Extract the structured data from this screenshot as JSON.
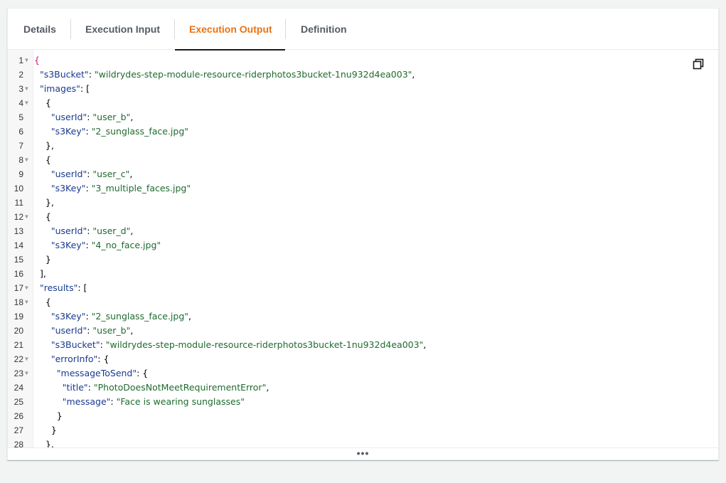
{
  "tabs": [
    {
      "label": "Details"
    },
    {
      "label": "Execution Input"
    },
    {
      "label": "Execution Output"
    },
    {
      "label": "Definition"
    }
  ],
  "active_tab": "Execution Output",
  "colors": {
    "active_tab": "#ec7211",
    "key": "#1a3a8f",
    "string": "#1e6b2e"
  },
  "icons": {
    "copy": "copy-icon",
    "fold": "fold-arrow-icon",
    "more": "ellipsis-icon"
  },
  "more_label": "•••",
  "code_lines": [
    {
      "n": "1",
      "fold": true,
      "parts": [
        {
          "t": "{",
          "c": "brace-hl"
        }
      ]
    },
    {
      "n": "2",
      "fold": false,
      "parts": [
        {
          "t": "  "
        },
        {
          "t": "\"s3Bucket\"",
          "c": "k"
        },
        {
          "t": ": "
        },
        {
          "t": "\"wildrydes-step-module-resource-riderphotos3bucket-1nu932d4ea003\"",
          "c": "s"
        },
        {
          "t": ","
        }
      ]
    },
    {
      "n": "3",
      "fold": true,
      "parts": [
        {
          "t": "  "
        },
        {
          "t": "\"images\"",
          "c": "k"
        },
        {
          "t": ": ["
        }
      ]
    },
    {
      "n": "4",
      "fold": true,
      "parts": [
        {
          "t": "    {"
        }
      ]
    },
    {
      "n": "5",
      "fold": false,
      "parts": [
        {
          "t": "      "
        },
        {
          "t": "\"userId\"",
          "c": "k"
        },
        {
          "t": ": "
        },
        {
          "t": "\"user_b\"",
          "c": "s"
        },
        {
          "t": ","
        }
      ]
    },
    {
      "n": "6",
      "fold": false,
      "parts": [
        {
          "t": "      "
        },
        {
          "t": "\"s3Key\"",
          "c": "k"
        },
        {
          "t": ": "
        },
        {
          "t": "\"2_sunglass_face.jpg\"",
          "c": "s"
        }
      ]
    },
    {
      "n": "7",
      "fold": false,
      "parts": [
        {
          "t": "    },"
        }
      ]
    },
    {
      "n": "8",
      "fold": true,
      "parts": [
        {
          "t": "    {"
        }
      ]
    },
    {
      "n": "9",
      "fold": false,
      "parts": [
        {
          "t": "      "
        },
        {
          "t": "\"userId\"",
          "c": "k"
        },
        {
          "t": ": "
        },
        {
          "t": "\"user_c\"",
          "c": "s"
        },
        {
          "t": ","
        }
      ]
    },
    {
      "n": "10",
      "fold": false,
      "parts": [
        {
          "t": "      "
        },
        {
          "t": "\"s3Key\"",
          "c": "k"
        },
        {
          "t": ": "
        },
        {
          "t": "\"3_multiple_faces.jpg\"",
          "c": "s"
        }
      ]
    },
    {
      "n": "11",
      "fold": false,
      "parts": [
        {
          "t": "    },"
        }
      ]
    },
    {
      "n": "12",
      "fold": true,
      "parts": [
        {
          "t": "    {"
        }
      ]
    },
    {
      "n": "13",
      "fold": false,
      "parts": [
        {
          "t": "      "
        },
        {
          "t": "\"userId\"",
          "c": "k"
        },
        {
          "t": ": "
        },
        {
          "t": "\"user_d\"",
          "c": "s"
        },
        {
          "t": ","
        }
      ]
    },
    {
      "n": "14",
      "fold": false,
      "parts": [
        {
          "t": "      "
        },
        {
          "t": "\"s3Key\"",
          "c": "k"
        },
        {
          "t": ": "
        },
        {
          "t": "\"4_no_face.jpg\"",
          "c": "s"
        }
      ]
    },
    {
      "n": "15",
      "fold": false,
      "parts": [
        {
          "t": "    }"
        }
      ]
    },
    {
      "n": "16",
      "fold": false,
      "parts": [
        {
          "t": "  ],"
        }
      ]
    },
    {
      "n": "17",
      "fold": true,
      "parts": [
        {
          "t": "  "
        },
        {
          "t": "\"results\"",
          "c": "k"
        },
        {
          "t": ": ["
        }
      ]
    },
    {
      "n": "18",
      "fold": true,
      "parts": [
        {
          "t": "    {"
        }
      ]
    },
    {
      "n": "19",
      "fold": false,
      "parts": [
        {
          "t": "      "
        },
        {
          "t": "\"s3Key\"",
          "c": "k"
        },
        {
          "t": ": "
        },
        {
          "t": "\"2_sunglass_face.jpg\"",
          "c": "s"
        },
        {
          "t": ","
        }
      ]
    },
    {
      "n": "20",
      "fold": false,
      "parts": [
        {
          "t": "      "
        },
        {
          "t": "\"userId\"",
          "c": "k"
        },
        {
          "t": ": "
        },
        {
          "t": "\"user_b\"",
          "c": "s"
        },
        {
          "t": ","
        }
      ]
    },
    {
      "n": "21",
      "fold": false,
      "parts": [
        {
          "t": "      "
        },
        {
          "t": "\"s3Bucket\"",
          "c": "k"
        },
        {
          "t": ": "
        },
        {
          "t": "\"wildrydes-step-module-resource-riderphotos3bucket-1nu932d4ea003\"",
          "c": "s"
        },
        {
          "t": ","
        }
      ]
    },
    {
      "n": "22",
      "fold": true,
      "parts": [
        {
          "t": "      "
        },
        {
          "t": "\"errorInfo\"",
          "c": "k"
        },
        {
          "t": ": {"
        }
      ]
    },
    {
      "n": "23",
      "fold": true,
      "parts": [
        {
          "t": "        "
        },
        {
          "t": "\"messageToSend\"",
          "c": "k"
        },
        {
          "t": ": {"
        }
      ]
    },
    {
      "n": "24",
      "fold": false,
      "parts": [
        {
          "t": "          "
        },
        {
          "t": "\"title\"",
          "c": "k"
        },
        {
          "t": ": "
        },
        {
          "t": "\"PhotoDoesNotMeetRequirementError\"",
          "c": "s"
        },
        {
          "t": ","
        }
      ]
    },
    {
      "n": "25",
      "fold": false,
      "parts": [
        {
          "t": "          "
        },
        {
          "t": "\"message\"",
          "c": "k"
        },
        {
          "t": ": "
        },
        {
          "t": "\"Face is wearing sunglasses\"",
          "c": "s"
        }
      ]
    },
    {
      "n": "26",
      "fold": false,
      "parts": [
        {
          "t": "        }"
        }
      ]
    },
    {
      "n": "27",
      "fold": false,
      "parts": [
        {
          "t": "      }"
        }
      ]
    },
    {
      "n": "28",
      "fold": false,
      "parts": [
        {
          "t": "    },"
        }
      ]
    }
  ]
}
